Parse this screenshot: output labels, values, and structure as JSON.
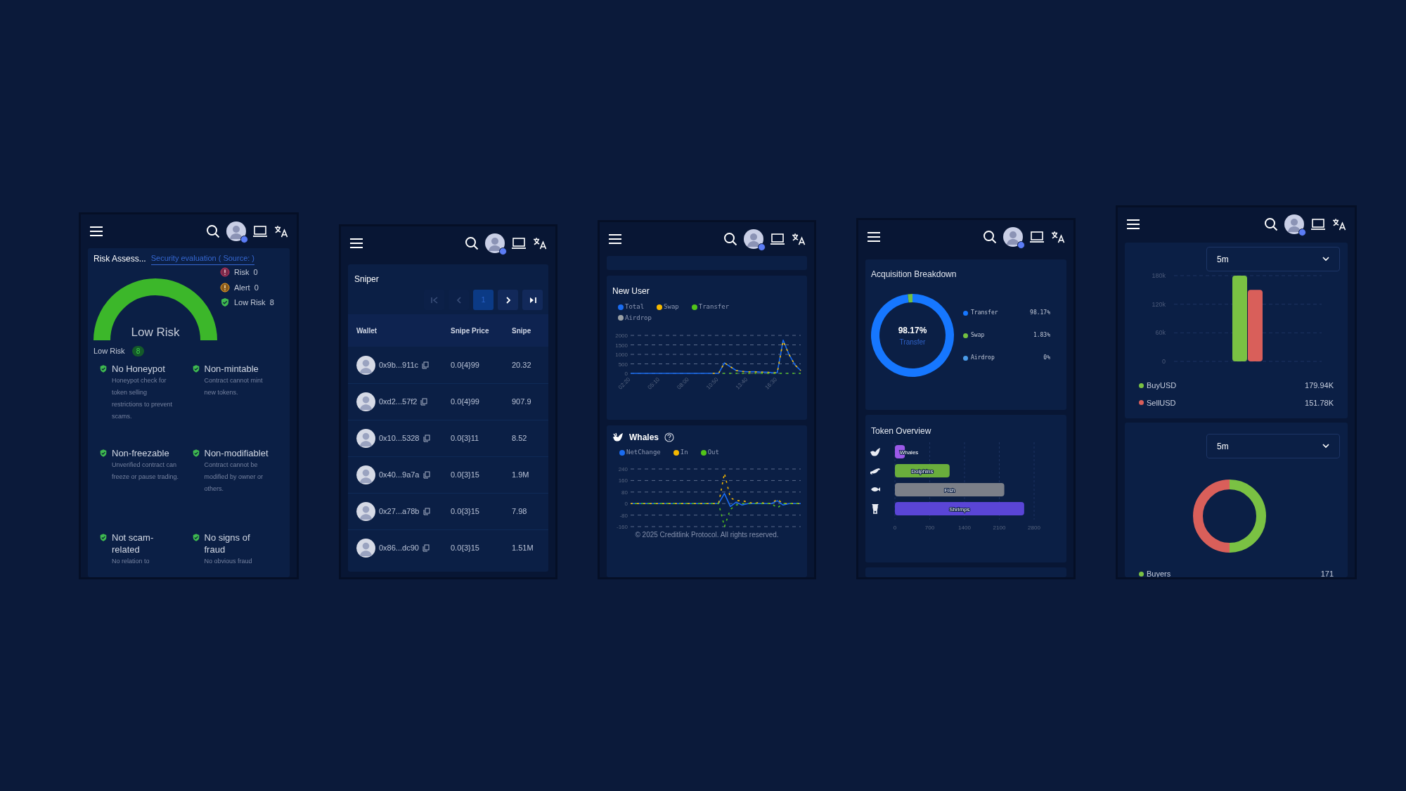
{
  "screens": [
    {
      "kind": "risk",
      "title": "Risk Assess...",
      "source_link": "Security evaluation ( Source: )",
      "gauge_label": "Low Risk",
      "summary": [
        {
          "kind": "risk",
          "label": "Risk",
          "count": "0"
        },
        {
          "kind": "alert",
          "label": "Alert",
          "count": "0"
        },
        {
          "kind": "low",
          "label": "Low Risk",
          "count": "8"
        }
      ],
      "group": {
        "label": "Low Risk",
        "count": "8"
      },
      "checks": [
        {
          "title": "No Honeypot",
          "description": "Honeypot check for token selling restrictions to prevent scams."
        },
        {
          "title": "Non-mintable",
          "description": "Contract cannot mint new tokens."
        },
        {
          "title": "Non-freezable",
          "description": "Unverified contract can freeze or pause trading."
        },
        {
          "title": "Non-modifiablet",
          "description": "Contract cannot be modified by owner or others."
        },
        {
          "title": "Not scam-related",
          "description": "No relation to"
        },
        {
          "title": "No signs of fraud",
          "description": "No obvious fraud"
        }
      ]
    },
    {
      "kind": "sniper",
      "title": "Sniper",
      "pager": {
        "controls": [
          {
            "kind": "first",
            "disabled": true
          },
          {
            "kind": "prev",
            "disabled": true
          },
          {
            "kind": "next",
            "disabled": false
          },
          {
            "kind": "last",
            "disabled": false
          }
        ],
        "pages": [
          {
            "label": "1",
            "selected": true
          }
        ]
      },
      "table": {
        "columns": [
          "Wallet",
          "Snipe Price",
          "Snipe"
        ],
        "rows": [
          {
            "wallet": "0x9b...911c",
            "snipe_price": "0.0{4}99",
            "column_3": "20.32"
          },
          {
            "wallet": "0xd2...57f2",
            "snipe_price": "0.0{4}99",
            "column_3": "907.9"
          },
          {
            "wallet": "0x10...5328",
            "snipe_price": "0.0{3}11",
            "column_3": "8.52"
          },
          {
            "wallet": "0x40...9a7a",
            "snipe_price": "0.0{3}15",
            "column_3": "1.9M"
          },
          {
            "wallet": "0x27...a78b",
            "snipe_price": "0.0{3}15",
            "column_3": "7.98"
          },
          {
            "wallet": "0x86...dc90",
            "snipe_price": "0.0{3}15",
            "column_3": "1.51M"
          }
        ]
      }
    },
    {
      "kind": "charts",
      "new_user": {
        "title": "New User",
        "chart_data": {
          "type": "line",
          "grid": true,
          "x": [
            140,
            174,
            208,
            242,
            276,
            310,
            344,
            378,
            412,
            446,
            480,
            514,
            548,
            582,
            616,
            650,
            684,
            718,
            752,
            786,
            820,
            854,
            888,
            922,
            956,
            990,
            1024,
            1058,
            1092,
            1126
          ],
          "xlim": [
            140,
            1126
          ],
          "xticks": [
            {
              "value": 140,
              "label": "02:20"
            },
            {
              "value": 310,
              "label": "05:10"
            },
            {
              "value": 480,
              "label": "08:00"
            },
            {
              "value": 650,
              "label": "10:50"
            },
            {
              "value": 820,
              "label": "13:40"
            },
            {
              "value": 990,
              "label": "16:30"
            }
          ],
          "ylim": [
            0,
            2000
          ],
          "yticks": [
            0,
            500,
            1000,
            1500,
            2000
          ],
          "series": [
            {
              "name": "Total",
              "color": "#1a6cf0",
              "line_style": "solid",
              "values": [
                0,
                0,
                0,
                0,
                0,
                0,
                0,
                0,
                0,
                0,
                0,
                0,
                0,
                0,
                0,
                0,
                550,
                350,
                150,
                100,
                80,
                90,
                70,
                60,
                40,
                30,
                1750,
                1000,
                450,
                150
              ]
            },
            {
              "name": "Swap",
              "color": "#f5b800",
              "line_style": "dashed",
              "values": [
                null,
                null,
                null,
                null,
                null,
                null,
                null,
                null,
                null,
                null,
                null,
                null,
                null,
                null,
                0,
                0,
                550,
                350,
                150,
                100,
                80,
                80,
                70,
                60,
                40,
                30,
                1700,
                1000,
                450,
                150
              ]
            },
            {
              "name": "Transfer",
              "color": "#52c41a",
              "line_style": "dashed",
              "values": [
                null,
                null,
                null,
                null,
                null,
                null,
                null,
                null,
                null,
                null,
                null,
                null,
                null,
                null,
                null,
                0,
                0,
                0,
                0,
                0,
                0,
                0,
                0,
                0,
                0,
                0,
                0,
                0,
                0,
                0
              ]
            },
            {
              "name": "Airdrop",
              "color": "#9aa0a6",
              "values": [
                null,
                null,
                null,
                null,
                null,
                null,
                null,
                null,
                null,
                null,
                null,
                null,
                null,
                null,
                null,
                null,
                null,
                null,
                null,
                null,
                null,
                null,
                null,
                null,
                null,
                null,
                null,
                null,
                null,
                null
              ]
            }
          ]
        }
      },
      "whales": {
        "title": "Whales",
        "chart_data": {
          "type": "line",
          "grid": true,
          "ylim": [
            -160,
            240
          ],
          "yticks": [
            -160,
            -80,
            0,
            80,
            160,
            240
          ],
          "series": [
            {
              "name": "NetChange",
              "color": "#1a6cf0",
              "line_style": "solid",
              "values": [
                0,
                0,
                0,
                0,
                0,
                0,
                0,
                0,
                0,
                0,
                0,
                0,
                0,
                0,
                0,
                0,
                70,
                -20,
                10,
                -10,
                0,
                0,
                0,
                0,
                0,
                20,
                -10,
                0,
                0,
                0
              ]
            },
            {
              "name": "In",
              "color": "#f5b800",
              "line_style": "dashed",
              "values": [
                0,
                0,
                0,
                0,
                0,
                0,
                0,
                0,
                0,
                0,
                0,
                0,
                0,
                0,
                0,
                0,
                210,
                40,
                20,
                20,
                10,
                0,
                10,
                0,
                0,
                30,
                0,
                0,
                0,
                0
              ]
            },
            {
              "name": "Out",
              "color": "#52c41a",
              "line_style": "dashed",
              "values": [
                0,
                0,
                0,
                0,
                0,
                0,
                0,
                0,
                0,
                0,
                0,
                0,
                0,
                0,
                0,
                0,
                -160,
                -40,
                -10,
                0,
                0,
                0,
                0,
                0,
                0,
                -30,
                0,
                0,
                0,
                0
              ]
            }
          ]
        }
      },
      "footer": "© 2025 Creditlink Protocol. All rights reserved."
    },
    {
      "kind": "breakdown",
      "acquisition": {
        "title": "Acquisition Breakdown",
        "center_value": "98.17%",
        "center_label": "Transfer",
        "legend": [
          {
            "value": "98.17%",
            "color": "#1677ff"
          },
          {
            "value": "1.83%",
            "color": "#73c040"
          },
          {
            "value": "0%",
            "color": "#4a9be8"
          }
        ],
        "chart_data": {
          "type": "donut",
          "categories": [
            "Transfer",
            "Swap",
            "Airdrop"
          ],
          "values": [
            98.17,
            1.83,
            0
          ]
        }
      },
      "token_overview": {
        "title": "Token Overview",
        "chart_data": {
          "type": "bar",
          "orientation": "horizontal",
          "grid": true,
          "xlim": [
            0,
            2800
          ],
          "xticks": [
            0,
            700,
            1400,
            2100,
            2800
          ],
          "series": [
            {
              "name": "Whales",
              "color": "#9b59e8",
              "values": [
                200
              ]
            },
            {
              "name": "Dolphins",
              "color": "#6aae3c",
              "values": [
                1100
              ]
            },
            {
              "name": "Fish",
              "color": "#7b7f88",
              "values": [
                2200
              ]
            },
            {
              "name": "Shrimps",
              "color": "#5a45d6",
              "values": [
                2600
              ]
            }
          ]
        }
      }
    },
    {
      "kind": "trades",
      "volume": {
        "interval": "5m",
        "chart_data": {
          "type": "bar",
          "grid": true,
          "ylim": [
            0,
            180000
          ],
          "yticks": [
            {
              "value": 0,
              "label": "0"
            },
            {
              "value": 60000,
              "label": "60k"
            },
            {
              "value": 120000,
              "label": "120k"
            },
            {
              "value": 180000,
              "label": "180k"
            }
          ],
          "series": [
            {
              "name": "BuyUSD",
              "color": "#7ac143",
              "values": [
                180000
              ]
            },
            {
              "name": "SellUSD",
              "color": "#d95f5a",
              "values": [
                150000
              ]
            }
          ]
        },
        "legend": [
          {
            "value": "179.94K"
          },
          {
            "value": "151.78K"
          }
        ]
      },
      "traders": {
        "interval": "5m",
        "legend": [
          {
            "label": "Buyers",
            "value": "171",
            "color": "#7ac143"
          }
        ]
      }
    }
  ]
}
